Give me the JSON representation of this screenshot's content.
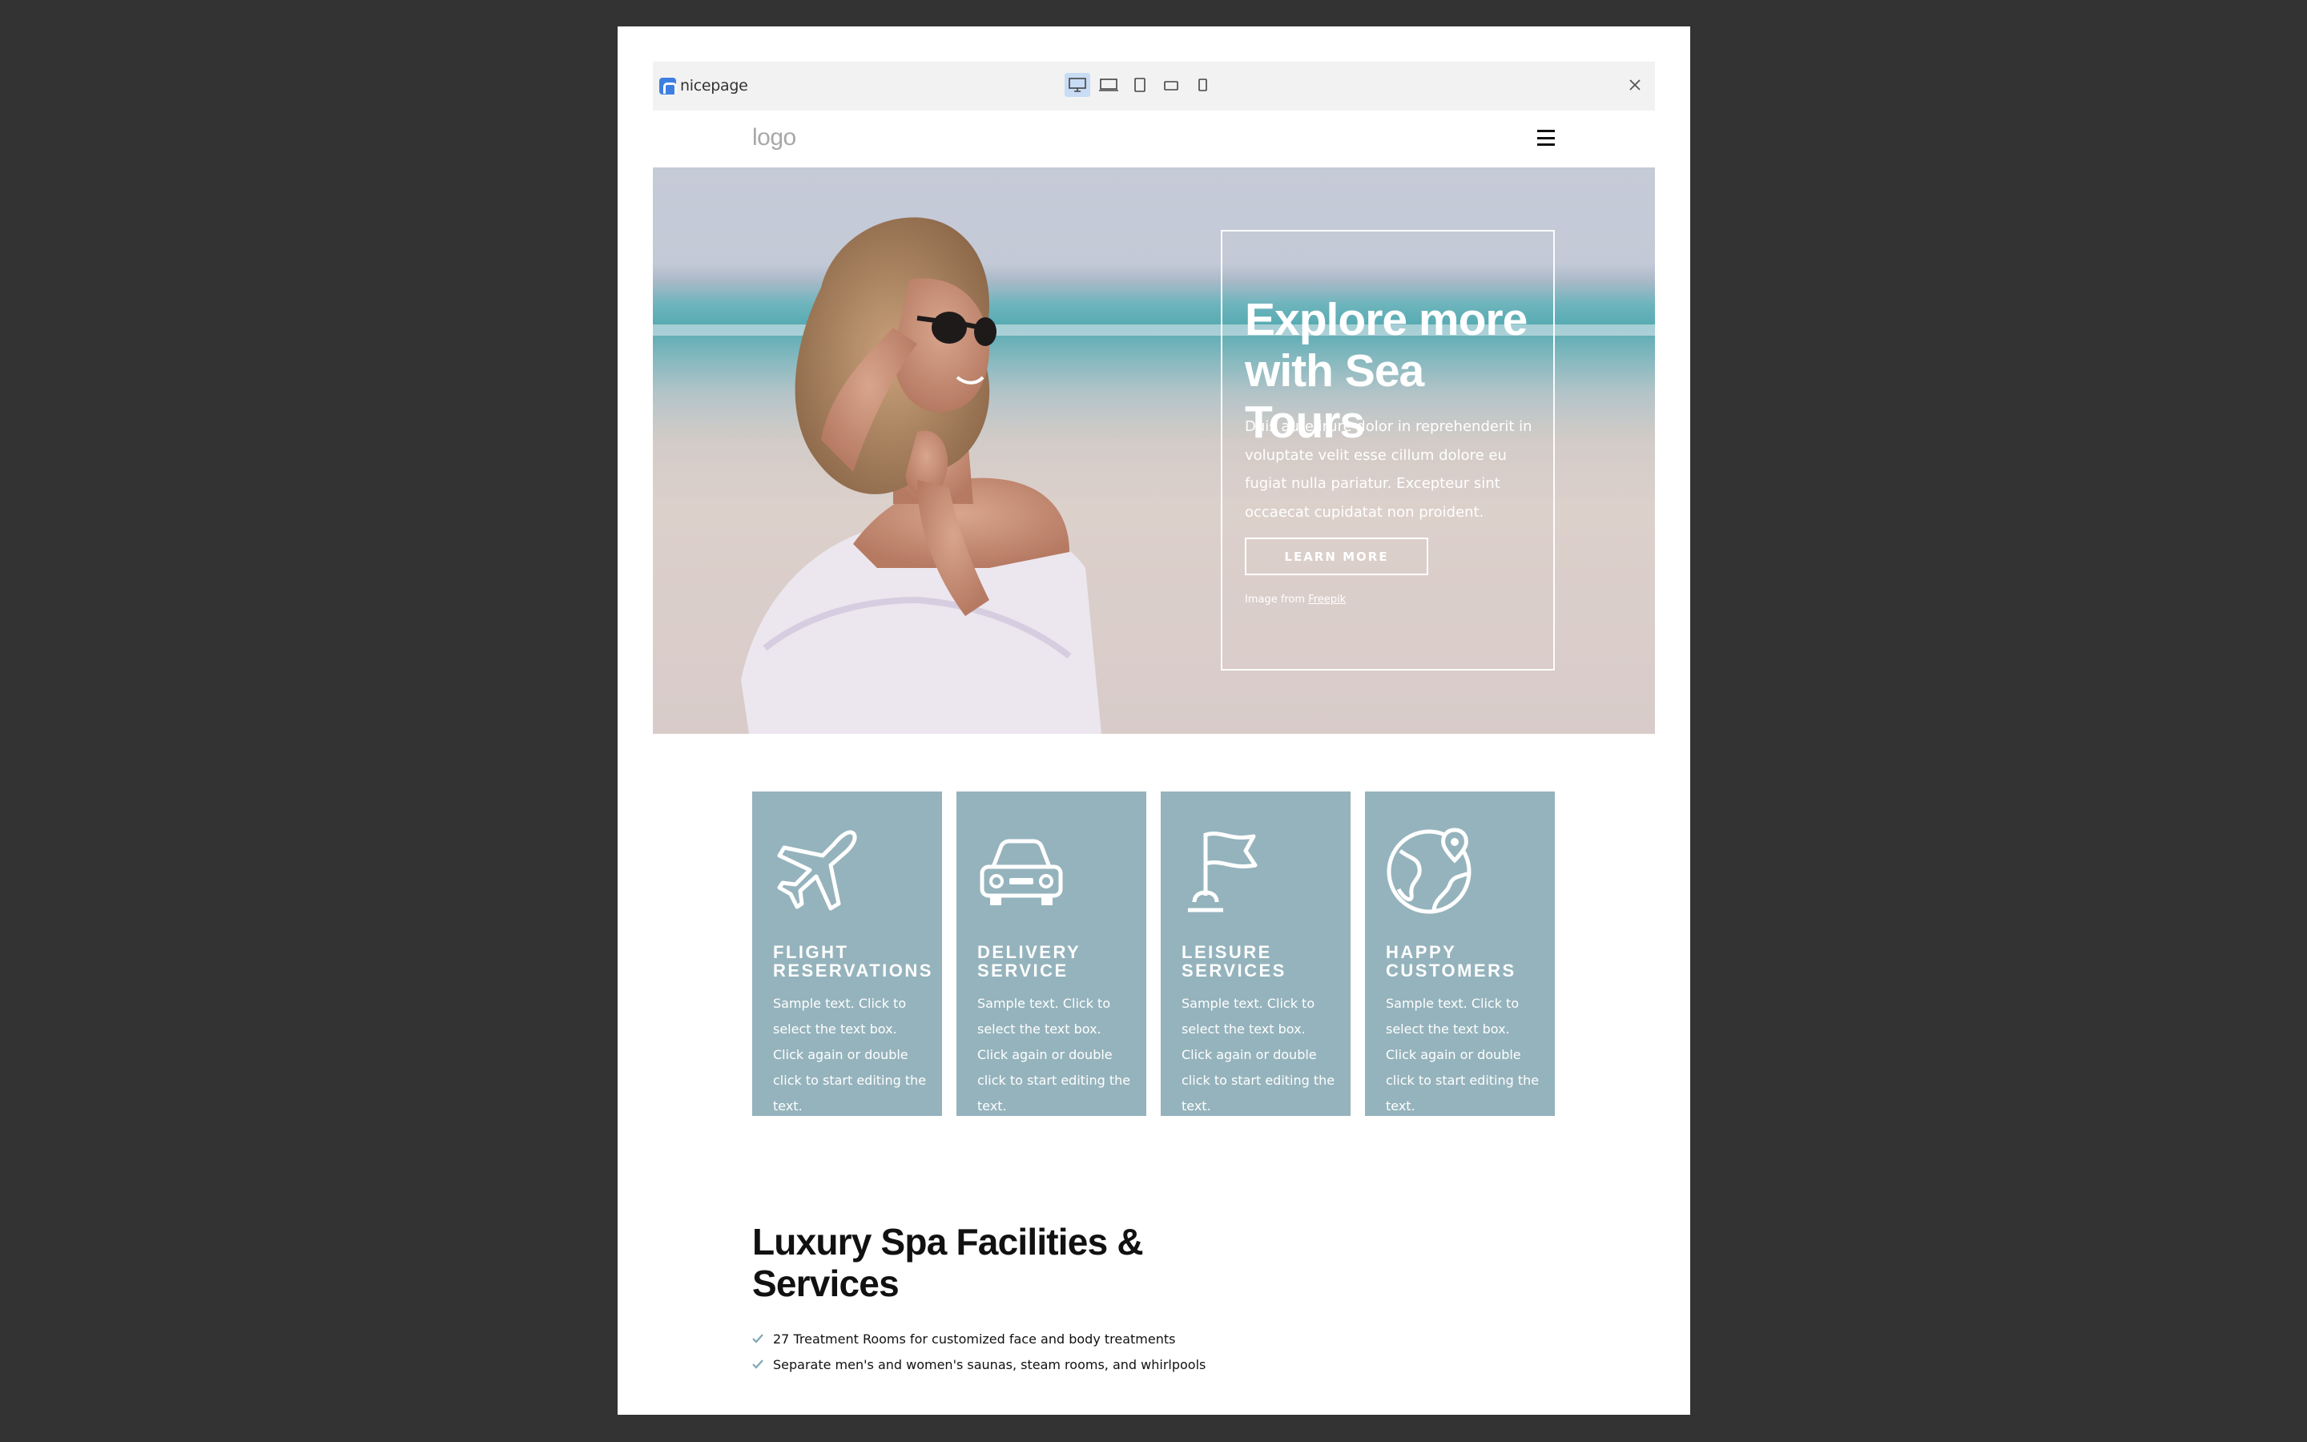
{
  "toolbar": {
    "brand": "nicepage",
    "devices": [
      "desktop",
      "laptop",
      "tablet",
      "phone-landscape",
      "phone"
    ],
    "close_icon": "close-icon"
  },
  "site": {
    "logo": "logo",
    "menu_icon": "hamburger-menu-icon"
  },
  "hero": {
    "title": "Explore more with Sea Tours",
    "text": "Duis aute irure dolor in reprehenderit in voluptate velit esse cillum dolore eu fugiat nulla pariatur. Excepteur sint occaecat cupidatat non proident.",
    "button": "LEARN MORE",
    "credit_prefix": "Image from ",
    "credit_link": "Freepik"
  },
  "cards": [
    {
      "icon": "airplane-icon",
      "title": "FLIGHT RESERVATIONS",
      "text": "Sample text. Click to select the text box. Click again or double click to start editing the text."
    },
    {
      "icon": "car-icon",
      "title": "DELIVERY SERVICE",
      "text": "Sample text. Click to select the text box. Click again or double click to start editing the text."
    },
    {
      "icon": "flag-icon",
      "title": "LEISURE SERVICES",
      "text": "Sample text. Click to select the text box. Click again or double click to start editing the text."
    },
    {
      "icon": "globe-pin-icon",
      "title": "HAPPY CUSTOMERS",
      "text": "Sample text. Click to select the text box. Click again or double click to start editing the text."
    }
  ],
  "spa": {
    "title": "Luxury Spa Facilities & Services",
    "items": [
      "27 Treatment Rooms for customized face and body treatments",
      "Separate men's and women's saunas, steam rooms, and whirlpools"
    ]
  },
  "colors": {
    "card_bg": "#95b3bc",
    "check": "#95b3bc",
    "device_active": "#c9dcf5",
    "brand": "#3d7fe0"
  }
}
